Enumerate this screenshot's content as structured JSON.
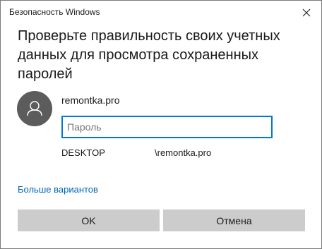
{
  "window": {
    "title": "Безопасность Windows"
  },
  "prompt": {
    "headline": "Проверьте правильность своих учетных данных для просмотра сохраненных паролей"
  },
  "account": {
    "name": "remontka.pro",
    "avatar_icon": "user-icon",
    "password_placeholder": "Пароль",
    "password_value": "",
    "domain_label": "DESKTOP",
    "domain_value": "\\remontka.pro"
  },
  "links": {
    "more_options": "Больше вариантов"
  },
  "buttons": {
    "ok": "OK",
    "cancel": "Отмена"
  },
  "colors": {
    "accent": "#0078d7",
    "link": "#0066b4",
    "avatar_bg": "#5c5c5c",
    "button_bg": "#cccccc"
  }
}
